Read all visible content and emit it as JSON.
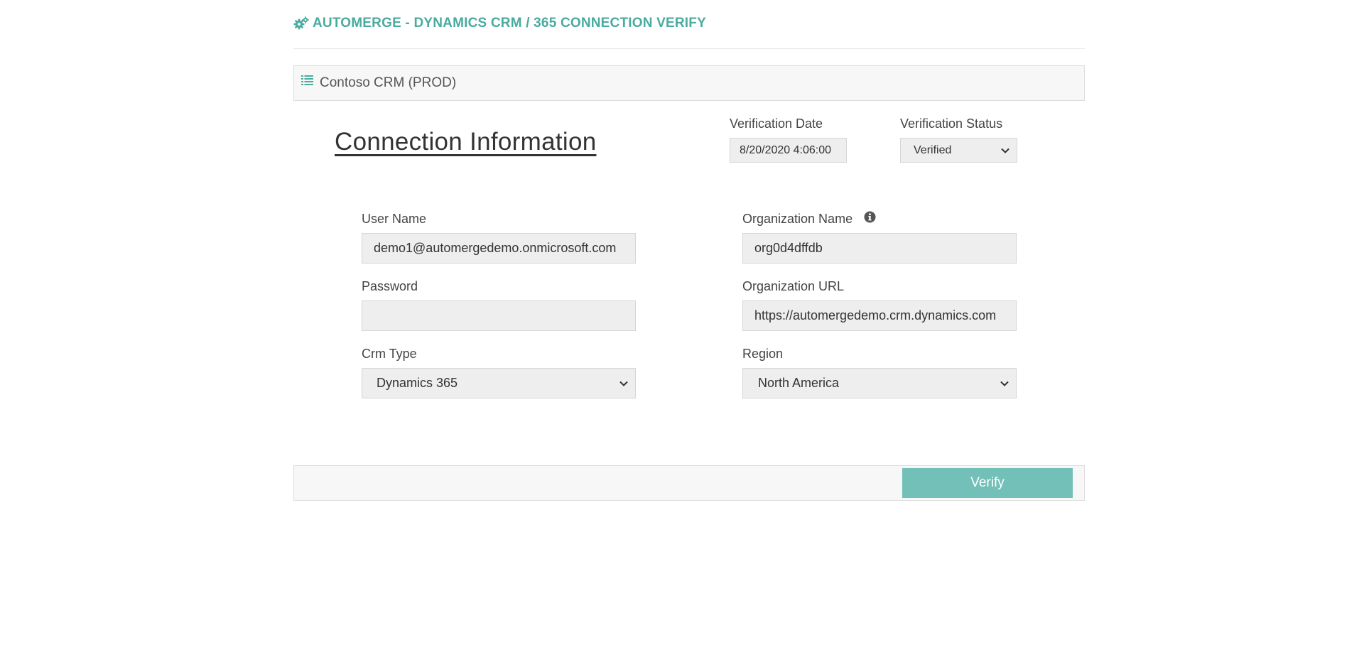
{
  "header": {
    "title": "AUTOMERGE - DYNAMICS CRM / 365 CONNECTION VERIFY",
    "icon": "gears-icon",
    "accent_color": "#4aab9f"
  },
  "panel": {
    "label": "Contoso CRM (PROD)",
    "icon": "list-icon"
  },
  "connection": {
    "title": "Connection Information"
  },
  "verification": {
    "date_label": "Verification Date",
    "date_value": "8/20/2020 4:06:00",
    "status_label": "Verification Status",
    "status_value": "Verified"
  },
  "form": {
    "user_name_label": "User Name",
    "user_name_value": "demo1@automergedemo.onmicrosoft.com",
    "password_label": "Password",
    "password_value": "",
    "crm_type_label": "Crm Type",
    "crm_type_value": "Dynamics 365",
    "org_name_label": "Organization Name",
    "org_name_value": "org0d4dffdb",
    "org_url_label": "Organization URL",
    "org_url_value": "https://automergedemo.crm.dynamics.com",
    "region_label": "Region",
    "region_value": "North America"
  },
  "footer": {
    "verify_label": "Verify",
    "button_color": "#72c0b7"
  }
}
